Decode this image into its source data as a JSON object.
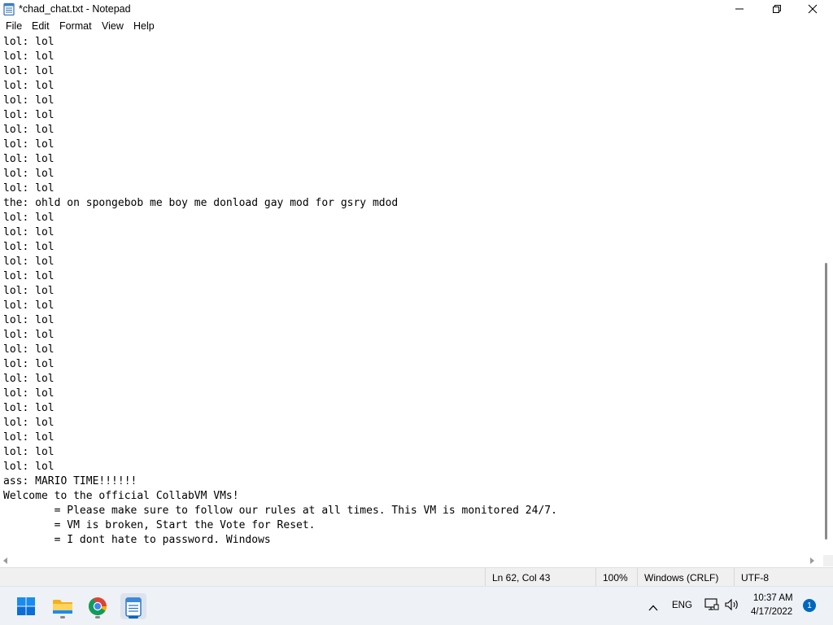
{
  "window": {
    "title": "*chad_chat.txt - Notepad",
    "app_icon": "notepad-icon"
  },
  "menu": [
    "File",
    "Edit",
    "Format",
    "View",
    "Help"
  ],
  "editor": {
    "lines": [
      "lol: lol",
      "lol: lol",
      "lol: lol",
      "lol: lol",
      "lol: lol",
      "lol: lol",
      "lol: lol",
      "lol: lol",
      "lol: lol",
      "lol: lol",
      "lol: lol",
      "the: ohld on spongebob me boy me donload gay mod for gsry mdod",
      "lol: lol",
      "lol: lol",
      "lol: lol",
      "lol: lol",
      "lol: lol",
      "lol: lol",
      "lol: lol",
      "lol: lol",
      "lol: lol",
      "lol: lol",
      "lol: lol",
      "lol: lol",
      "lol: lol",
      "lol: lol",
      "lol: lol",
      "lol: lol",
      "lol: lol",
      "lol: lol",
      "ass: MARIO TIME!!!!!!",
      "Welcome to the official CollabVM VMs!",
      "        = Please make sure to follow our rules at all times. This VM is monitored 24/7.",
      "        = VM is broken, Start the Vote for Reset.",
      "        = I dont hate to password. Windows"
    ]
  },
  "status": {
    "position": "Ln 62, Col 43",
    "zoom": "100%",
    "line_ending": "Windows (CRLF)",
    "encoding": "UTF-8"
  },
  "taskbar": {
    "apps": [
      "start-icon",
      "file-explorer-icon",
      "chrome-icon",
      "notepad-icon"
    ],
    "active_app": "notepad-icon",
    "language": "ENG",
    "time": "10:37 AM",
    "date": "4/17/2022",
    "notifications": "1"
  },
  "colors": {
    "accent": "#0067c0",
    "statusbar_bg": "#f0f0f0",
    "taskbar_bg": "#eef1f6"
  }
}
